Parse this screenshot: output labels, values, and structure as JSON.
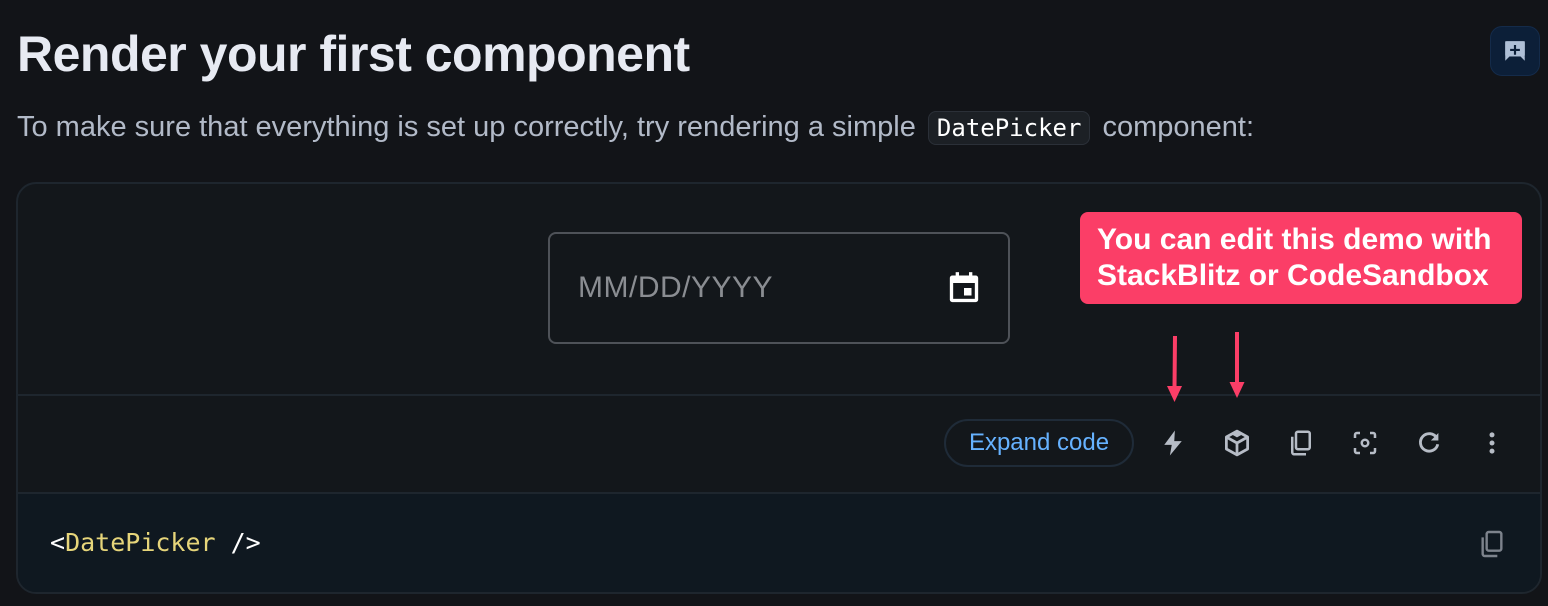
{
  "heading": {
    "title": "Render your first component",
    "intro_before": "To make sure that everything is set up correctly, try rendering a simple",
    "intro_code": "DatePicker",
    "intro_after": "component:"
  },
  "feedback_button": {
    "icon": "add-comment-icon",
    "label": "Add feedback"
  },
  "demo": {
    "date_field": {
      "placeholder": "MM/DD/YYYY",
      "value": "",
      "icon": "calendar-icon"
    },
    "toolbar": {
      "expand_label": "Expand code",
      "icons": [
        {
          "name": "stackblitz-icon",
          "label": "Edit in StackBlitz"
        },
        {
          "name": "codesandbox-icon",
          "label": "Edit in CodeSandbox"
        },
        {
          "name": "copy-icon",
          "label": "Copy source"
        },
        {
          "name": "focus-icon",
          "label": "Focus demo"
        },
        {
          "name": "reset-icon",
          "label": "Reset demo"
        },
        {
          "name": "more-vert-icon",
          "label": "More options"
        }
      ]
    },
    "code": {
      "open": "<",
      "tag": "DatePicker",
      "close": " />",
      "copy_icon": "copy-icon"
    }
  },
  "annotation": {
    "text_line1": "You can edit this demo with",
    "text_line2": "StackBlitz or CodeSandbox",
    "color": "#fb3e67"
  },
  "colors": {
    "background": "#121418",
    "accent_link": "#66b2ff",
    "code_tag": "#e6d57a"
  }
}
